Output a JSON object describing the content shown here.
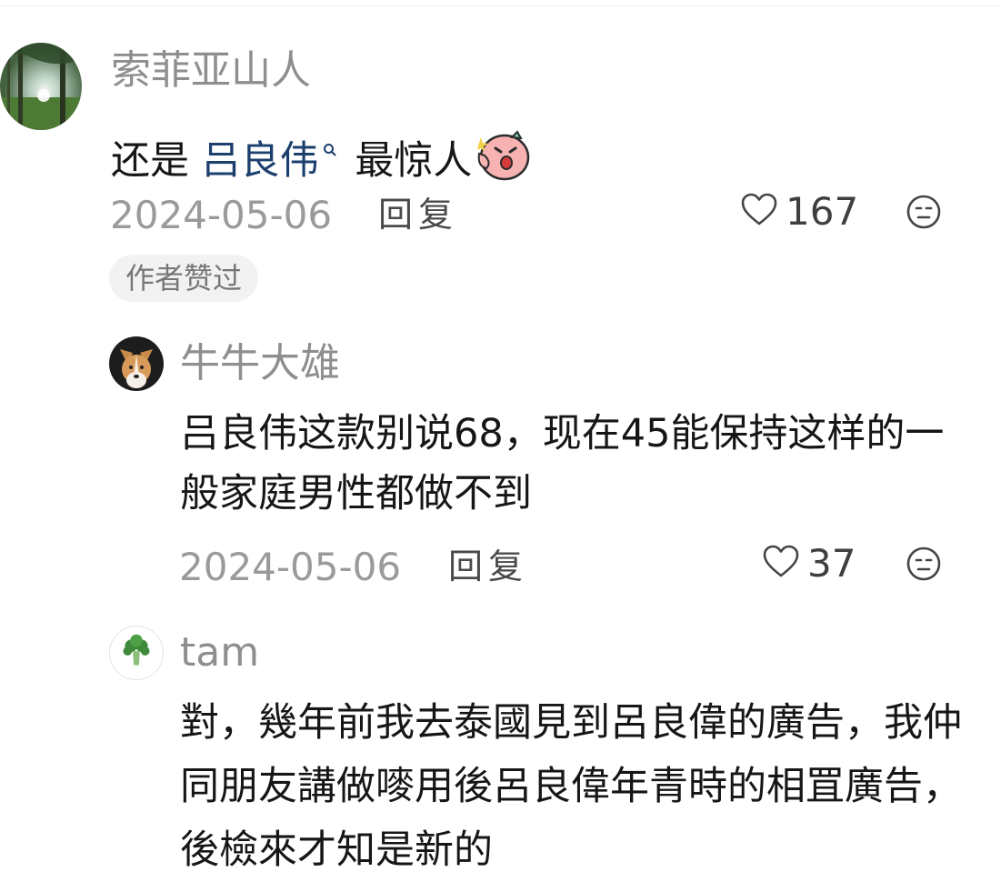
{
  "comments": [
    {
      "username": "索菲亚山人",
      "content_prefix": "还是 ",
      "content_link": "吕良伟",
      "content_suffix": " 最惊人",
      "date": "2024-05-06",
      "reply_label": "回复",
      "likes": "167",
      "badge": "作者赞过"
    },
    {
      "username": "牛牛大雄",
      "content": "吕良伟这款别说68，现在45能保持这样的一般家庭男性都做不到",
      "date": "2024-05-06",
      "reply_label": "回复",
      "likes": "37"
    },
    {
      "username": "tam",
      "content": "對，幾年前我去泰國見到呂良偉的廣告，我仲同朋友講做嘜用後呂良偉年青時的相罝廣告，後檢來才知是新的"
    }
  ],
  "icons": {
    "search": "search-icon",
    "emoji": "surprised-face-sticker-icon",
    "like": "heart-outline-icon",
    "more": "neutral-face-icon"
  },
  "colors": {
    "link": "#1c3f6e",
    "username": "#8e8e8e",
    "date": "#9a9a9a",
    "badge_bg": "#f2f2f2"
  }
}
